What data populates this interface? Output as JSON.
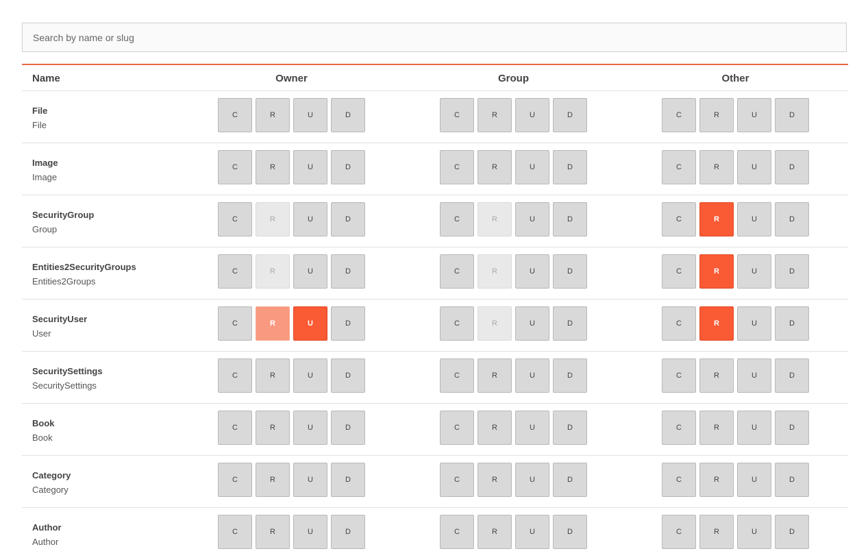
{
  "search": {
    "placeholder": "Search by name or slug",
    "value": ""
  },
  "columns": {
    "name": "Name",
    "owner": "Owner",
    "group": "Group",
    "other": "Other"
  },
  "perm_labels": [
    "C",
    "R",
    "U",
    "D"
  ],
  "colors": {
    "accent": "#e5673f",
    "active": "#fa5a34",
    "partial": "#f99a80",
    "default": "#d9d9d9",
    "inherited": "#e9e9e9"
  },
  "rows": [
    {
      "name": "File",
      "slug": "File",
      "owner": [
        "off",
        "off",
        "off",
        "off"
      ],
      "group": [
        "off",
        "off",
        "off",
        "off"
      ],
      "other": [
        "off",
        "off",
        "off",
        "off"
      ]
    },
    {
      "name": "Image",
      "slug": "Image",
      "owner": [
        "off",
        "off",
        "off",
        "off"
      ],
      "group": [
        "off",
        "off",
        "off",
        "off"
      ],
      "other": [
        "off",
        "off",
        "off",
        "off"
      ]
    },
    {
      "name": "SecurityGroup",
      "slug": "Group",
      "owner": [
        "off",
        "inherited",
        "off",
        "off"
      ],
      "group": [
        "off",
        "inherited",
        "off",
        "off"
      ],
      "other": [
        "off",
        "on",
        "off",
        "off"
      ]
    },
    {
      "name": "Entities2SecurityGroups",
      "slug": "Entities2Groups",
      "owner": [
        "off",
        "inherited",
        "off",
        "off"
      ],
      "group": [
        "off",
        "inherited",
        "off",
        "off"
      ],
      "other": [
        "off",
        "on",
        "off",
        "off"
      ]
    },
    {
      "name": "SecurityUser",
      "slug": "User",
      "owner": [
        "off",
        "partial",
        "on",
        "off"
      ],
      "group": [
        "off",
        "inherited",
        "off",
        "off"
      ],
      "other": [
        "off",
        "on",
        "off",
        "off"
      ]
    },
    {
      "name": "SecuritySettings",
      "slug": "SecuritySettings",
      "owner": [
        "off",
        "off",
        "off",
        "off"
      ],
      "group": [
        "off",
        "off",
        "off",
        "off"
      ],
      "other": [
        "off",
        "off",
        "off",
        "off"
      ]
    },
    {
      "name": "Book",
      "slug": "Book",
      "owner": [
        "off",
        "off",
        "off",
        "off"
      ],
      "group": [
        "off",
        "off",
        "off",
        "off"
      ],
      "other": [
        "off",
        "off",
        "off",
        "off"
      ]
    },
    {
      "name": "Category",
      "slug": "Category",
      "owner": [
        "off",
        "off",
        "off",
        "off"
      ],
      "group": [
        "off",
        "off",
        "off",
        "off"
      ],
      "other": [
        "off",
        "off",
        "off",
        "off"
      ]
    },
    {
      "name": "Author",
      "slug": "Author",
      "owner": [
        "off",
        "off",
        "off",
        "off"
      ],
      "group": [
        "off",
        "off",
        "off",
        "off"
      ],
      "other": [
        "off",
        "off",
        "off",
        "off"
      ]
    }
  ]
}
